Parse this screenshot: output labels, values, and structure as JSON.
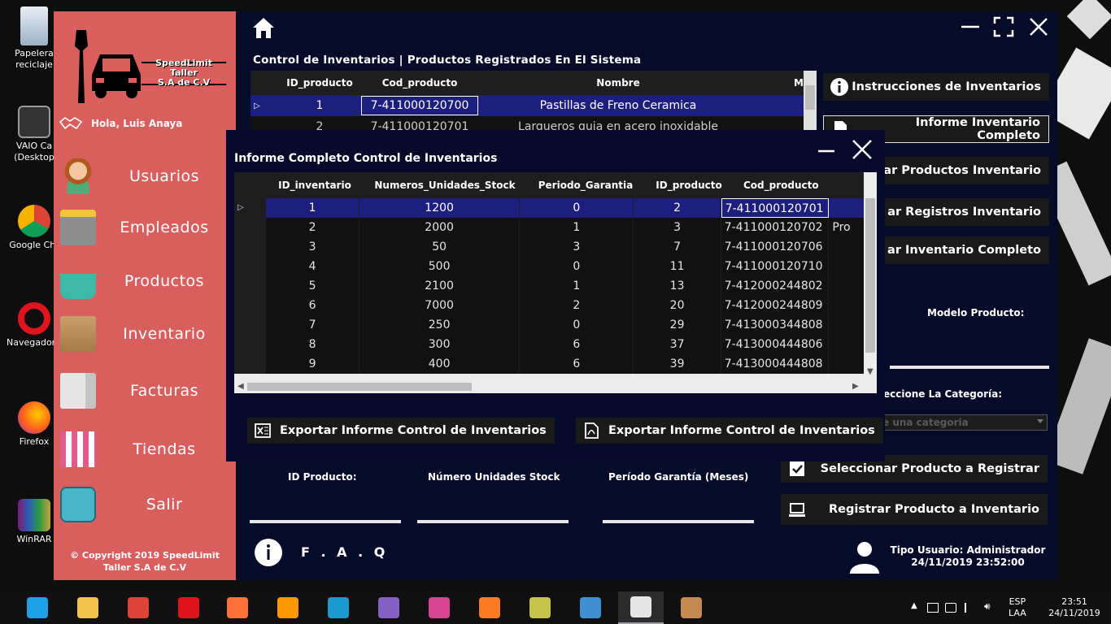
{
  "desktop": {
    "icons": [
      {
        "label": "Papelera de reciclaje",
        "line1": "Papelera",
        "line2": "reciclaje"
      },
      {
        "label": "VAIO Care (Desktop)",
        "line1": "VAIO Ca",
        "line2": "(Desktop"
      },
      {
        "label": "Google Chrome",
        "line1": "Google Chr",
        "line2": ""
      },
      {
        "label": "Navegador Opera",
        "line1": "Navegador (",
        "line2": ""
      },
      {
        "label": "Firefox",
        "line1": "Firefox",
        "line2": ""
      },
      {
        "label": "WinRAR",
        "line1": "WinRAR",
        "line2": ""
      }
    ]
  },
  "sidebar": {
    "brand_line1": "SpeedLimit Taller",
    "brand_line2": "S.A de C.V",
    "greeting": "Hola, Luis Anaya",
    "items": [
      {
        "label": "Usuarios",
        "icon": "user-icon"
      },
      {
        "label": "Empleados",
        "icon": "id-badge-icon"
      },
      {
        "label": "Productos",
        "icon": "shopping-basket-icon"
      },
      {
        "label": "Inventario",
        "icon": "box-icon"
      },
      {
        "label": "Facturas",
        "icon": "invoice-icon"
      },
      {
        "label": "Tiendas",
        "icon": "store-icon"
      },
      {
        "label": "Salir",
        "icon": "exit-icon"
      }
    ],
    "copyright_line1": "© Copyright 2019 SpeedLimit",
    "copyright_line2": "Taller S.A de C.V"
  },
  "main": {
    "section_title": "Control de Inventarios  |  Productos Registrados En El Sistema",
    "products_grid": {
      "columns": [
        "ID_producto",
        "Cod_producto",
        "Nombre",
        "M"
      ],
      "rows": [
        {
          "id": "1",
          "cod": "7-411000120700",
          "nombre": "Pastillas de Freno Ceramica"
        },
        {
          "id": "2",
          "cod": "7-411000120701",
          "nombre": "Largueros guia en acero inoxidable"
        }
      ]
    },
    "buttons": {
      "instrucciones": "Instrucciones de Inventarios",
      "informe_completo": "Informe Inventario Completo",
      "productos_inventario": "ar Productos Inventario",
      "registros_inventario": "ar Registros Inventario",
      "inventario_completo": "ar Inventario Completo",
      "seleccionar": "Seleccionar Producto a Registrar",
      "registrar": "Registrar Producto a Inventario"
    },
    "modelo_label": "Modelo Producto:",
    "categoria_label": "eccione La Categoría:",
    "categoria_placeholder": "e una categoria",
    "fields": {
      "id_producto": "ID Producto:",
      "unidades_stock": "Número Unidades Stock",
      "periodo_garantia": "Período Garantía (Meses)"
    },
    "faq": "F . A . Q",
    "tipo_usuario": "Tipo Usuario: Administrador",
    "datetime": "24/11/2019 23:52:00"
  },
  "modal": {
    "title": "Informe Completo Control de Inventarios",
    "columns": [
      "ID_inventario",
      "Numeros_Unidades_Stock",
      "Periodo_Garantia",
      "ID_producto",
      "Cod_producto"
    ],
    "rows": [
      [
        "1",
        "1200",
        "0",
        "2",
        "7-411000120701",
        ""
      ],
      [
        "2",
        "2000",
        "1",
        "3",
        "7-411000120702",
        "Pro"
      ],
      [
        "3",
        "50",
        "3",
        "7",
        "7-411000120706",
        ""
      ],
      [
        "4",
        "500",
        "0",
        "11",
        "7-411000120710",
        ""
      ],
      [
        "5",
        "2100",
        "1",
        "13",
        "7-412000244802",
        ""
      ],
      [
        "6",
        "7000",
        "2",
        "20",
        "7-412000244809",
        ""
      ],
      [
        "7",
        "250",
        "0",
        "29",
        "7-413000344808",
        ""
      ],
      [
        "8",
        "300",
        "6",
        "37",
        "7-413000444806",
        ""
      ],
      [
        "9",
        "400",
        "6",
        "39",
        "7-413000444808",
        ""
      ]
    ],
    "export_excel": "Exportar Informe Control de Inventarios",
    "export_pdf": "Exportar Informe Control de Inventarios"
  },
  "taskbar": {
    "apps": [
      "internet-explorer-icon",
      "file-explorer-icon",
      "chrome-icon",
      "opera-icon",
      "firefox-icon",
      "sublime-text-icon",
      "powershell-icon",
      "visual-studio-icon",
      "wamp-icon",
      "xampp-icon",
      "tools-icon",
      "virtualbox-icon",
      "plug-icon",
      "paint-icon"
    ],
    "lang_line1": "ESP",
    "lang_line2": "LAA",
    "time": "23:51",
    "date": "24/11/2019"
  },
  "colors": {
    "sidebar": "#d85f5e",
    "window_bg": "#060b2a",
    "selected_row": "#1d1f7e"
  }
}
